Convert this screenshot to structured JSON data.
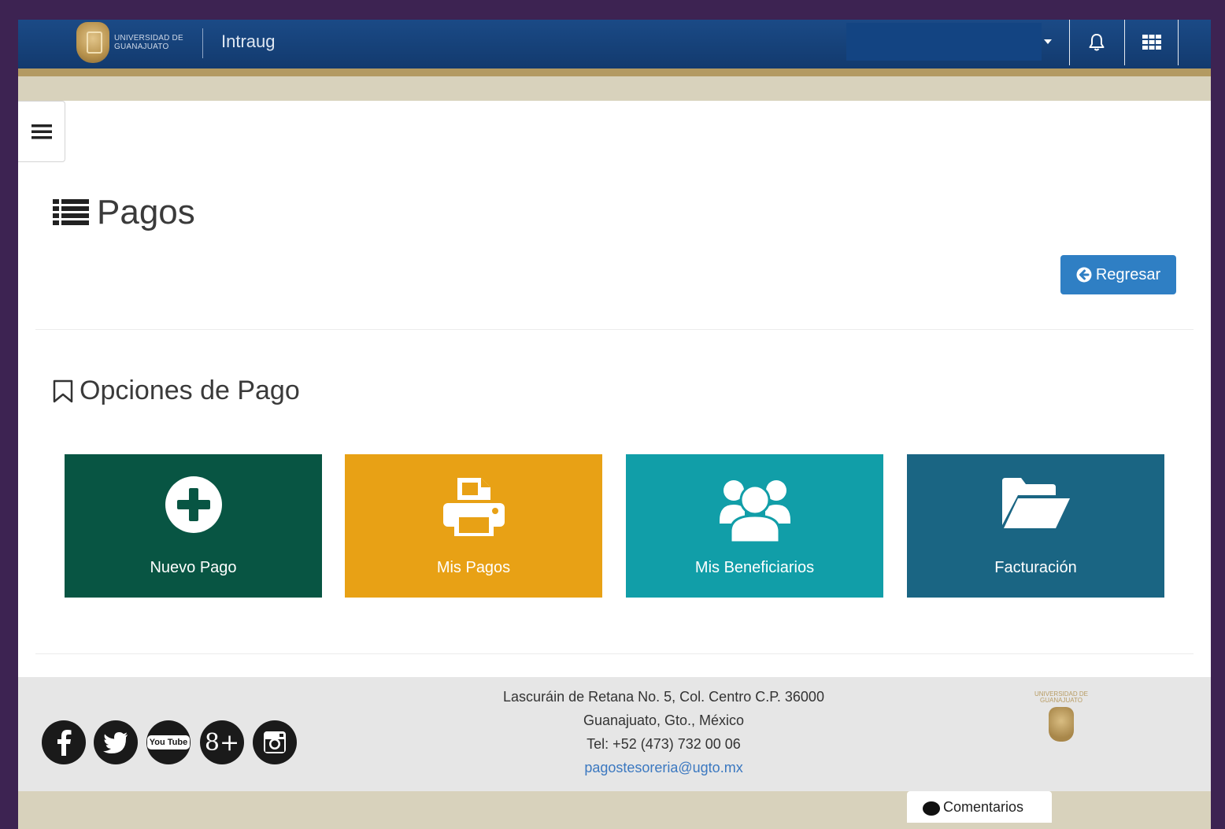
{
  "header": {
    "logo_line1": "UNIVERSIDAD DE",
    "logo_line2": "GUANAJUATO",
    "app_title": "Intraug",
    "user_select_value": ""
  },
  "page": {
    "title": "Pagos",
    "back_button": "Regresar",
    "section_title": "Opciones de Pago"
  },
  "tiles": [
    {
      "label": "Nuevo Pago",
      "color": "#085543",
      "icon": "plus-circle-icon"
    },
    {
      "label": "Mis Pagos",
      "color": "#e8a115",
      "icon": "printer-icon"
    },
    {
      "label": "Mis Beneficiarios",
      "color": "#119ea8",
      "icon": "users-icon"
    },
    {
      "label": "Facturación",
      "color": "#1a6583",
      "icon": "folder-open-icon"
    }
  ],
  "footer": {
    "address_line1": "Lascuráin de Retana No. 5, Col. Centro C.P. 36000",
    "address_line2": "Guanajuato, Gto., México",
    "phone": "Tel: +52 (473) 732 00 06",
    "email": "pagostesoreria@ugto.mx",
    "logo_line1": "UNIVERSIDAD DE",
    "logo_line2": "GUANAJUATO",
    "social": [
      "facebook-icon",
      "twitter-icon",
      "youtube-icon",
      "google-plus-icon",
      "instagram-icon"
    ],
    "youtube_text": "You Tube",
    "gplus_text": "8+"
  },
  "feedback": {
    "label": "Comentarios"
  },
  "colors": {
    "navbar": "#123a6e",
    "gold": "#b39a62",
    "beige": "#d8d2bc",
    "primary_button": "#2f7fc4"
  }
}
